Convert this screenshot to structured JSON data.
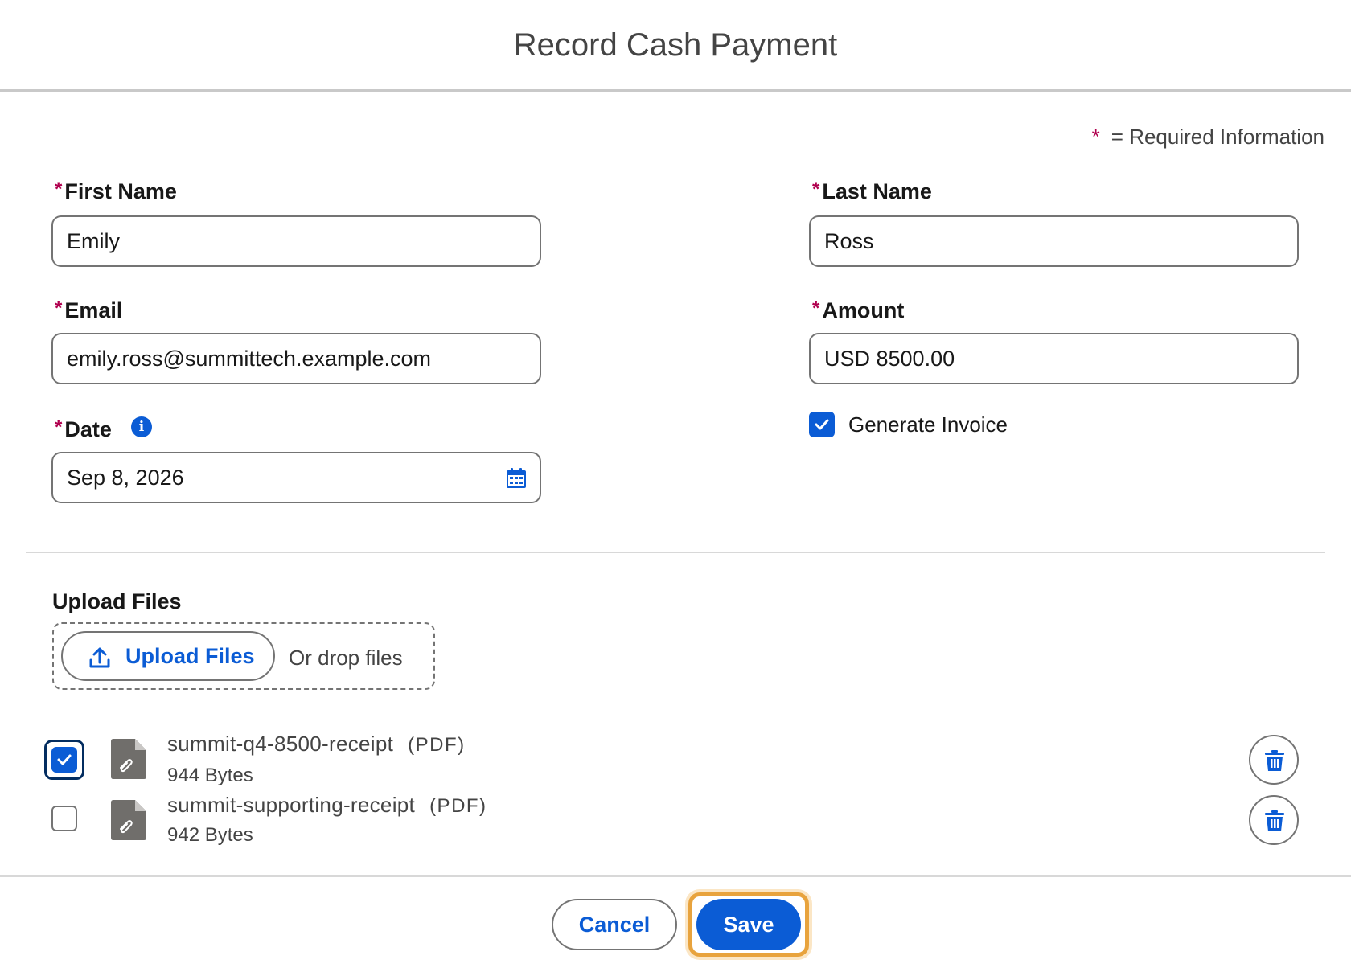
{
  "dialog": {
    "title": "Record Cash Payment",
    "required_star": "*",
    "required_note": "= Required Information"
  },
  "form": {
    "first_name": {
      "label": "First Name",
      "value": "Emily"
    },
    "last_name": {
      "label": "Last Name",
      "value": "Ross"
    },
    "email": {
      "label": "Email",
      "value": "emily.ross@summittech.example.com"
    },
    "amount": {
      "label": "Amount",
      "value": "USD 8500.00"
    },
    "date": {
      "label": "Date",
      "value": "Sep 8, 2026",
      "info_icon": "info-icon",
      "picker_icon": "calendar-icon"
    },
    "generate_invoice": {
      "label": "Generate Invoice",
      "checked": true
    }
  },
  "upload": {
    "section_label": "Upload Files",
    "button_label": "Upload Files",
    "drop_text": "Or drop files",
    "button_icon": "upload-icon"
  },
  "files": [
    {
      "name": "summit-q4-8500-receipt",
      "ext": "(PDF)",
      "size": "944 Bytes",
      "selected": true
    },
    {
      "name": "summit-supporting-receipt",
      "ext": "(PDF)",
      "size": "942 Bytes",
      "selected": false
    }
  ],
  "footer": {
    "cancel_label": "Cancel",
    "save_label": "Save"
  },
  "colors": {
    "brand_blue": "#0b5cd5",
    "required_star": "#b0004e",
    "focus_highlight": "#e8a33d"
  }
}
